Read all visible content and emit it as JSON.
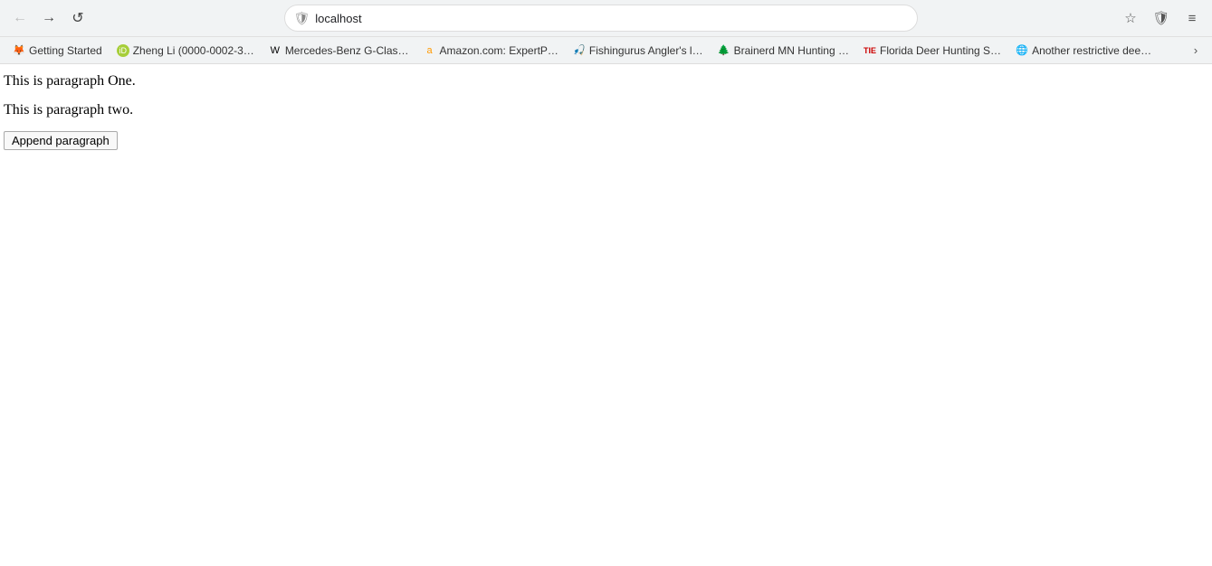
{
  "browser": {
    "address": "localhost",
    "nav": {
      "back_label": "←",
      "forward_label": "→",
      "reload_label": "↺"
    },
    "toolbar_icons": {
      "bookmark_label": "☆",
      "firefox_protect_label": "🛡",
      "menu_label": "≡"
    }
  },
  "bookmarks": [
    {
      "id": "getting-started",
      "label": "Getting Started",
      "favicon_type": "firefox"
    },
    {
      "id": "zheng-li",
      "label": "Zheng Li (0000-0002-3…",
      "favicon_type": "orcid"
    },
    {
      "id": "mercedes",
      "label": "Mercedes-Benz G-Clas…",
      "favicon_type": "wiki"
    },
    {
      "id": "amazon",
      "label": "Amazon.com: ExpertP…",
      "favicon_type": "amazon"
    },
    {
      "id": "fishingurus",
      "label": "Fishingurus Angler's l…",
      "favicon_type": "fish"
    },
    {
      "id": "brainerd",
      "label": "Brainerd MN Hunting …",
      "favicon_type": "tree"
    },
    {
      "id": "florida-deer",
      "label": "Florida Deer Hunting S…",
      "favicon_type": "tr"
    },
    {
      "id": "another-restrictive",
      "label": "Another restrictive dee…",
      "favicon_type": "globe"
    }
  ],
  "page": {
    "paragraph1": "This is paragraph One.",
    "paragraph2": "This is paragraph two.",
    "append_button_label": "Append paragraph"
  }
}
